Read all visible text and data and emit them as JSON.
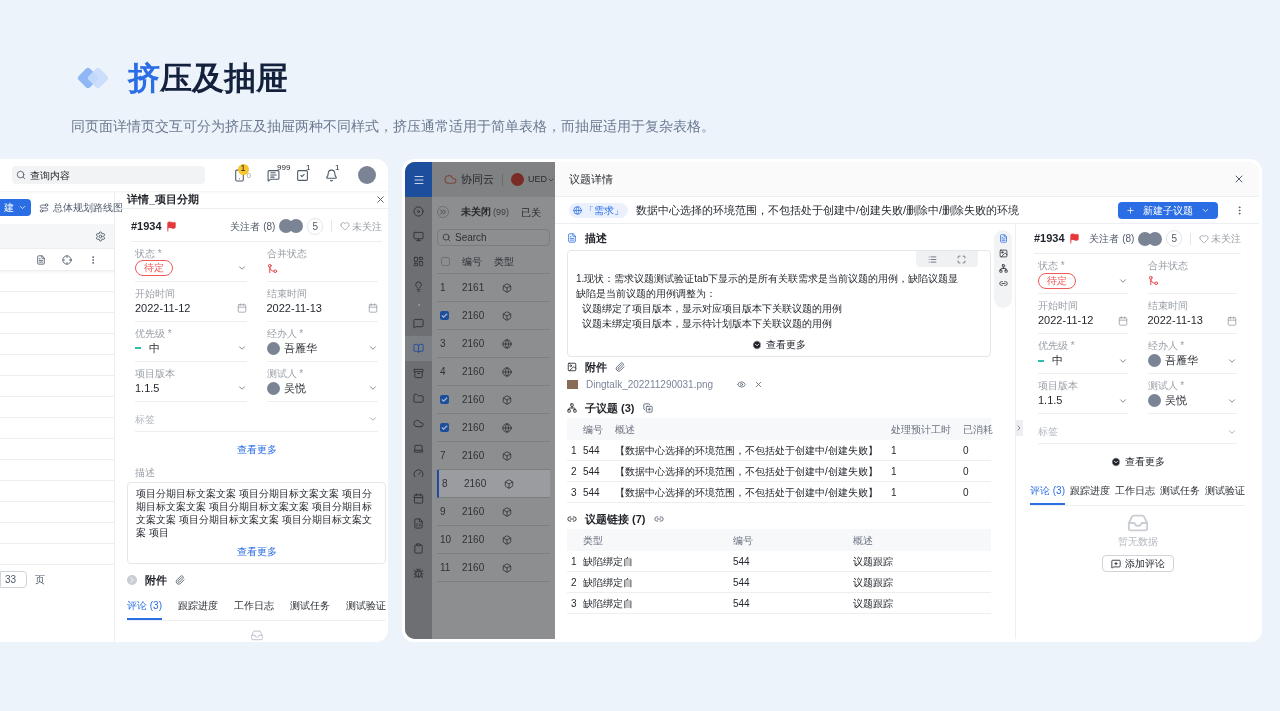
{
  "header": {
    "title_accent": "挤",
    "title_rest": "压及抽屉",
    "subtitle": "同页面详情页交互可分为挤压及抽屉两种不同样式，挤压通常适用于简单表格，而抽屉适用于复杂表格。"
  },
  "squeeze": {
    "search": {
      "value": "查询内容"
    },
    "top_icons": [
      {
        "kind": "phone",
        "badge": "1",
        "count": "0"
      },
      {
        "kind": "message",
        "badge": "999"
      },
      {
        "kind": "task",
        "badge": "1"
      },
      {
        "kind": "bell",
        "badge": "1"
      }
    ],
    "new_button": "建",
    "roadmap": "总体规划路线图",
    "page": "33",
    "page_unit": "页",
    "detail": {
      "title": "详情_项目分期",
      "id": "#1934",
      "followers": "关注者 (8)",
      "follower_count": "5",
      "follow": "未关注",
      "fields": [
        {
          "label": "状态 *",
          "kind": "tag",
          "value": "待定"
        },
        {
          "label": "合并状态",
          "kind": "merge"
        },
        {
          "label": "开始时间",
          "kind": "date",
          "value": "2022-11-12"
        },
        {
          "label": "结束时间",
          "kind": "date",
          "value": "2022-11-13"
        },
        {
          "label": "优先级 *",
          "kind": "priority",
          "value": "中"
        },
        {
          "label": "经办人 *",
          "kind": "person",
          "value": "吾雁华"
        },
        {
          "label": "项目版本",
          "kind": "select",
          "value": "1.1.5"
        },
        {
          "label": "测试人 *",
          "kind": "person",
          "value": "吴悦"
        }
      ],
      "tags_placeholder": "标签",
      "more": "查看更多",
      "description": {
        "label": "描述",
        "text": "项目分期目标文案文案 项目分期目标文案文案 项目分期目标文案文案 项目分期目标文案文案 项目分期目标文案文案 项目分期目标文案文案 项目分期目标文案文案 项目",
        "more": "查看更多"
      },
      "attachments": "附件",
      "tabs": [
        {
          "label": "评论 (3)",
          "selected": true
        },
        {
          "label": "跟踪进度",
          "selected": false
        },
        {
          "label": "工作日志",
          "selected": false
        },
        {
          "label": "测试任务",
          "selected": false
        },
        {
          "label": "测试验证",
          "selected": false
        }
      ]
    }
  },
  "drawer_demo": {
    "app": {
      "logo": "协同云",
      "org": "UED",
      "nav": [
        {
          "selected": false
        },
        {
          "selected": false
        },
        {
          "selected": false
        },
        {
          "selected": false
        },
        {
          "selected": false
        },
        {
          "selected": true
        },
        {
          "selected": false
        },
        {
          "selected": false
        },
        {
          "selected": false
        },
        {
          "selected": false
        },
        {
          "selected": false
        },
        {
          "selected": false
        },
        {
          "selected": false
        },
        {
          "selected": false
        },
        {
          "selected": false
        }
      ],
      "tabs": [
        {
          "label": "未关闭",
          "count": "(99)",
          "selected": true
        },
        {
          "label": "已关",
          "selected": false
        }
      ],
      "search_placeholder": "Search",
      "select_all": {
        "checked": false
      },
      "columns": [
        "编号",
        "类型"
      ],
      "rows": [
        {
          "number": "1",
          "checked": false,
          "id": "2161",
          "kind": "cube",
          "selected": false
        },
        {
          "checked": true,
          "id": "2160",
          "kind": "cube",
          "selected": false
        },
        {
          "number": "3",
          "checked": false,
          "id": "2160",
          "kind": "globe",
          "selected": false
        },
        {
          "number": "4",
          "checked": false,
          "id": "2160",
          "kind": "globe",
          "selected": false
        },
        {
          "checked": true,
          "id": "2160",
          "kind": "cube",
          "selected": false
        },
        {
          "checked": true,
          "id": "2160",
          "kind": "globe",
          "selected": false
        },
        {
          "number": "7",
          "checked": false,
          "id": "2160",
          "kind": "cube",
          "selected": false
        },
        {
          "number": "8",
          "checked": false,
          "id": "2160",
          "kind": "cube",
          "selected": true
        },
        {
          "number": "9",
          "checked": false,
          "id": "2160",
          "kind": "cube",
          "selected": false
        },
        {
          "number": "10",
          "checked": false,
          "id": "2160",
          "kind": "cube",
          "selected": false
        },
        {
          "number": "11",
          "checked": false,
          "id": "2160",
          "kind": "cube",
          "selected": false
        }
      ]
    },
    "drawer": {
      "title": "议题详情",
      "type_tag": "「需求」",
      "issue_title": "数据中心选择的环境范围，不包括处于创建中/创建失败/删除中/删除失败的环境",
      "new_button": "新建子议题",
      "description": {
        "label": "描述",
        "lines": [
          "1.现状：需求议题测试验证tab下显示的是所有关联需求是当前议题的用例，缺陷议题显",
          "缺陷是当前议题的用例调整为：",
          "议题绑定了项目版本，显示对应项目版本下关联议题的用例",
          "议题未绑定项目版本，显示待计划版本下关联议题的用例"
        ],
        "more": "查看更多"
      },
      "attachments": {
        "label": "附件",
        "file": "Dingtalk_202211290031.png"
      },
      "subissues": {
        "label": "子议题 (3)",
        "columns": [
          "",
          "编号",
          "概述",
          "处理预计工时",
          "已消耗"
        ],
        "rows": [
          [
            "1",
            "544",
            "【数据中心选择的环境范围，不包括处于创建中/创建失败】",
            "1",
            "0"
          ],
          [
            "2",
            "544",
            "【数据中心选择的环境范围，不包括处于创建中/创建失败】",
            "1",
            "0"
          ],
          [
            "3",
            "544",
            "【数据中心选择的环境范围，不包括处于创建中/创建失败】",
            "1",
            "0"
          ]
        ]
      },
      "links": {
        "label": "议题链接 (7)",
        "columns": [
          "",
          "类型",
          "编号",
          "概述"
        ],
        "rows": [
          [
            "1",
            "缺陷绑定自",
            "544",
            "议题跟踪"
          ],
          [
            "2",
            "缺陷绑定自",
            "544",
            "议题跟踪"
          ],
          [
            "3",
            "缺陷绑定自",
            "544",
            "议题跟踪"
          ]
        ]
      },
      "detail": {
        "id": "#1934",
        "followers": "关注者 (8)",
        "follower_count": "5",
        "follow": "未关注",
        "fields": [
          {
            "label": "状态 *",
            "kind": "tag",
            "value": "待定"
          },
          {
            "label": "合并状态",
            "kind": "merge"
          },
          {
            "label": "开始时间",
            "kind": "date",
            "value": "2022-11-12"
          },
          {
            "label": "结束时间",
            "kind": "date",
            "value": "2022-11-13"
          },
          {
            "label": "优先级 *",
            "kind": "priority",
            "value": "中"
          },
          {
            "label": "经办人 *",
            "kind": "person",
            "value": "吾雁华"
          },
          {
            "label": "项目版本",
            "kind": "select",
            "value": "1.1.5"
          },
          {
            "label": "测试人 *",
            "kind": "person",
            "value": "吴悦"
          }
        ],
        "tags_placeholder": "标签",
        "more": "查看更多",
        "tabs": [
          {
            "label": "评论 (3)",
            "selected": true
          },
          {
            "label": "跟踪进度",
            "selected": false
          },
          {
            "label": "工作日志",
            "selected": false
          },
          {
            "label": "测试任务",
            "selected": false
          },
          {
            "label": "测试验证",
            "selected": false
          }
        ],
        "empty": "暂无数据",
        "add_comment": "添加评论"
      }
    }
  }
}
